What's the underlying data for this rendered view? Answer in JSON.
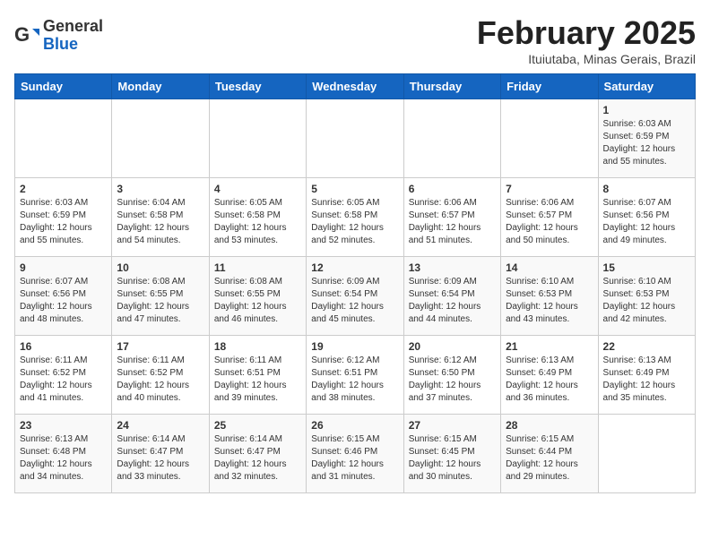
{
  "header": {
    "logo_general": "General",
    "logo_blue": "Blue",
    "month_title": "February 2025",
    "subtitle": "Ituiutaba, Minas Gerais, Brazil"
  },
  "weekdays": [
    "Sunday",
    "Monday",
    "Tuesday",
    "Wednesday",
    "Thursday",
    "Friday",
    "Saturday"
  ],
  "weeks": [
    [
      {
        "day": "",
        "info": ""
      },
      {
        "day": "",
        "info": ""
      },
      {
        "day": "",
        "info": ""
      },
      {
        "day": "",
        "info": ""
      },
      {
        "day": "",
        "info": ""
      },
      {
        "day": "",
        "info": ""
      },
      {
        "day": "1",
        "info": "Sunrise: 6:03 AM\nSunset: 6:59 PM\nDaylight: 12 hours\nand 55 minutes."
      }
    ],
    [
      {
        "day": "2",
        "info": "Sunrise: 6:03 AM\nSunset: 6:59 PM\nDaylight: 12 hours\nand 55 minutes."
      },
      {
        "day": "3",
        "info": "Sunrise: 6:04 AM\nSunset: 6:58 PM\nDaylight: 12 hours\nand 54 minutes."
      },
      {
        "day": "4",
        "info": "Sunrise: 6:05 AM\nSunset: 6:58 PM\nDaylight: 12 hours\nand 53 minutes."
      },
      {
        "day": "5",
        "info": "Sunrise: 6:05 AM\nSunset: 6:58 PM\nDaylight: 12 hours\nand 52 minutes."
      },
      {
        "day": "6",
        "info": "Sunrise: 6:06 AM\nSunset: 6:57 PM\nDaylight: 12 hours\nand 51 minutes."
      },
      {
        "day": "7",
        "info": "Sunrise: 6:06 AM\nSunset: 6:57 PM\nDaylight: 12 hours\nand 50 minutes."
      },
      {
        "day": "8",
        "info": "Sunrise: 6:07 AM\nSunset: 6:56 PM\nDaylight: 12 hours\nand 49 minutes."
      }
    ],
    [
      {
        "day": "9",
        "info": "Sunrise: 6:07 AM\nSunset: 6:56 PM\nDaylight: 12 hours\nand 48 minutes."
      },
      {
        "day": "10",
        "info": "Sunrise: 6:08 AM\nSunset: 6:55 PM\nDaylight: 12 hours\nand 47 minutes."
      },
      {
        "day": "11",
        "info": "Sunrise: 6:08 AM\nSunset: 6:55 PM\nDaylight: 12 hours\nand 46 minutes."
      },
      {
        "day": "12",
        "info": "Sunrise: 6:09 AM\nSunset: 6:54 PM\nDaylight: 12 hours\nand 45 minutes."
      },
      {
        "day": "13",
        "info": "Sunrise: 6:09 AM\nSunset: 6:54 PM\nDaylight: 12 hours\nand 44 minutes."
      },
      {
        "day": "14",
        "info": "Sunrise: 6:10 AM\nSunset: 6:53 PM\nDaylight: 12 hours\nand 43 minutes."
      },
      {
        "day": "15",
        "info": "Sunrise: 6:10 AM\nSunset: 6:53 PM\nDaylight: 12 hours\nand 42 minutes."
      }
    ],
    [
      {
        "day": "16",
        "info": "Sunrise: 6:11 AM\nSunset: 6:52 PM\nDaylight: 12 hours\nand 41 minutes."
      },
      {
        "day": "17",
        "info": "Sunrise: 6:11 AM\nSunset: 6:52 PM\nDaylight: 12 hours\nand 40 minutes."
      },
      {
        "day": "18",
        "info": "Sunrise: 6:11 AM\nSunset: 6:51 PM\nDaylight: 12 hours\nand 39 minutes."
      },
      {
        "day": "19",
        "info": "Sunrise: 6:12 AM\nSunset: 6:51 PM\nDaylight: 12 hours\nand 38 minutes."
      },
      {
        "day": "20",
        "info": "Sunrise: 6:12 AM\nSunset: 6:50 PM\nDaylight: 12 hours\nand 37 minutes."
      },
      {
        "day": "21",
        "info": "Sunrise: 6:13 AM\nSunset: 6:49 PM\nDaylight: 12 hours\nand 36 minutes."
      },
      {
        "day": "22",
        "info": "Sunrise: 6:13 AM\nSunset: 6:49 PM\nDaylight: 12 hours\nand 35 minutes."
      }
    ],
    [
      {
        "day": "23",
        "info": "Sunrise: 6:13 AM\nSunset: 6:48 PM\nDaylight: 12 hours\nand 34 minutes."
      },
      {
        "day": "24",
        "info": "Sunrise: 6:14 AM\nSunset: 6:47 PM\nDaylight: 12 hours\nand 33 minutes."
      },
      {
        "day": "25",
        "info": "Sunrise: 6:14 AM\nSunset: 6:47 PM\nDaylight: 12 hours\nand 32 minutes."
      },
      {
        "day": "26",
        "info": "Sunrise: 6:15 AM\nSunset: 6:46 PM\nDaylight: 12 hours\nand 31 minutes."
      },
      {
        "day": "27",
        "info": "Sunrise: 6:15 AM\nSunset: 6:45 PM\nDaylight: 12 hours\nand 30 minutes."
      },
      {
        "day": "28",
        "info": "Sunrise: 6:15 AM\nSunset: 6:44 PM\nDaylight: 12 hours\nand 29 minutes."
      },
      {
        "day": "",
        "info": ""
      }
    ]
  ]
}
